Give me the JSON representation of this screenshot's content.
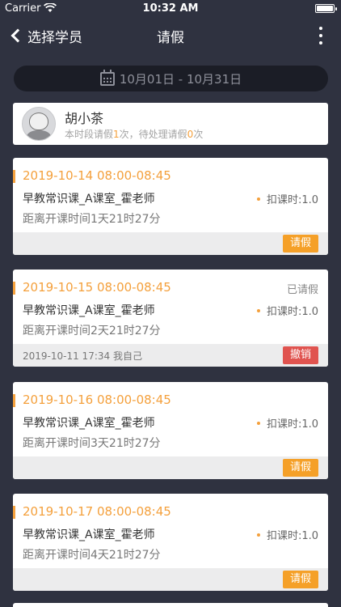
{
  "status_bar": {
    "carrier": "Carrier",
    "time": "10:32 AM"
  },
  "nav": {
    "back_label": "选择学员",
    "title": "请假"
  },
  "date_range": {
    "text": "10月01日 - 10月31日"
  },
  "student": {
    "name": "胡小茶",
    "stats_prefix": "本时段请假",
    "leave_count": "1",
    "stats_middle": "次，待处理请假",
    "pending_count": "0",
    "stats_suffix": "次"
  },
  "lessons": [
    {
      "date": "2019-10-14 08:00-08:45",
      "status": "",
      "course": "早教常识课_A课室_霍老师",
      "deduct": "扣课时:1.0",
      "countdown": "距离开课时间1天21时27分",
      "note": "",
      "button": "请假",
      "button_type": "leave"
    },
    {
      "date": "2019-10-15 08:00-08:45",
      "status": "已请假",
      "course": "早教常识课_A课室_霍老师",
      "deduct": "扣课时:1.0",
      "countdown": "距离开课时间2天21时27分",
      "note": "2019-10-11 17:34 我自己",
      "button": "撤销",
      "button_type": "cancel"
    },
    {
      "date": "2019-10-16 08:00-08:45",
      "status": "",
      "course": "早教常识课_A课室_霍老师",
      "deduct": "扣课时:1.0",
      "countdown": "距离开课时间3天21时27分",
      "note": "",
      "button": "请假",
      "button_type": "leave"
    },
    {
      "date": "2019-10-17 08:00-08:45",
      "status": "",
      "course": "早教常识课_A课室_霍老师",
      "deduct": "扣课时:1.0",
      "countdown": "距离开课时间4天21时27分",
      "note": "",
      "button": "请假",
      "button_type": "leave"
    }
  ],
  "colors": {
    "background": "#2f3240",
    "accent": "#f4a03c",
    "leave_button": "#f5a028",
    "cancel_button": "#e0534f"
  },
  "icons": {
    "back": "chevron-left-icon",
    "more": "more-vertical-icon",
    "calendar": "calendar-icon",
    "avatar": "child-avatar"
  }
}
